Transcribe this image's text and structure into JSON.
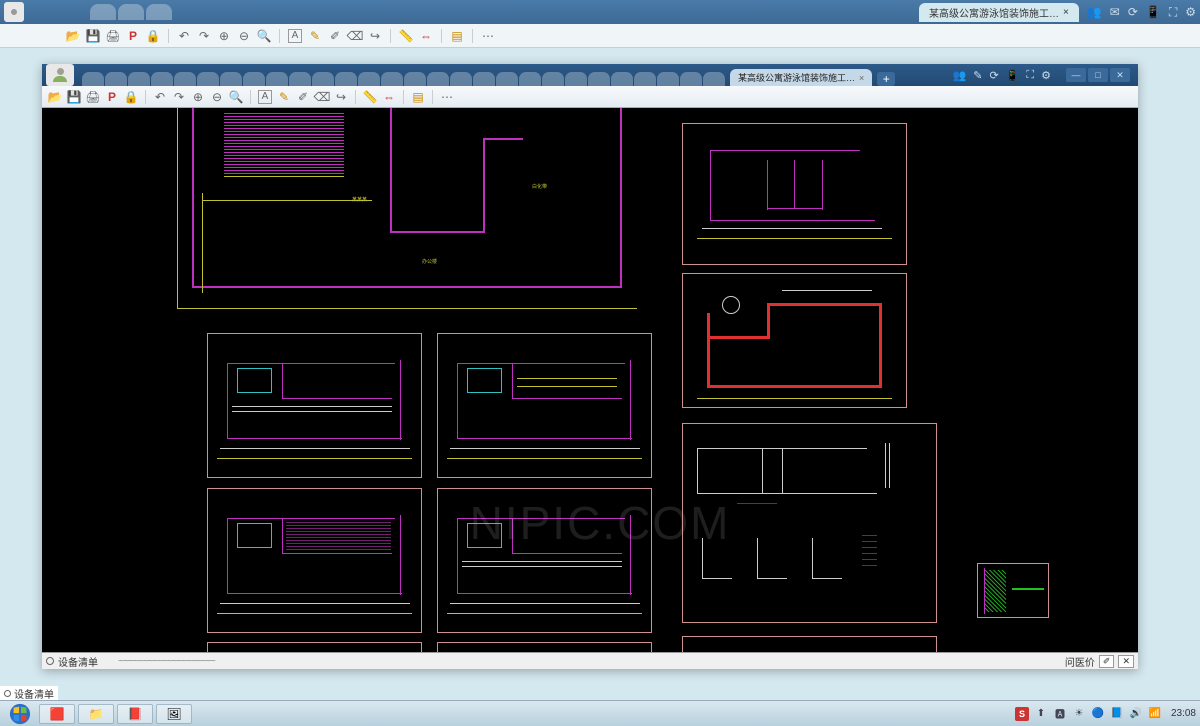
{
  "outer": {
    "tab_title": "某高级公寓游泳馆装饰施工…",
    "tab_close": "×",
    "right_icons": [
      "👥",
      "✉",
      "⟳",
      "📱",
      "⛶",
      "⚙"
    ]
  },
  "inner": {
    "tab_title": "某高级公寓游泳馆装饰施工…",
    "tab_close": "×",
    "plus": "+",
    "right_icons": [
      "👥",
      "✎",
      "⟳",
      "📱",
      "⛶",
      "⚙"
    ],
    "win_min": "—",
    "win_max": "□",
    "win_close": "✕"
  },
  "toolbar": {
    "open": "📂",
    "save": "💾",
    "print": "🖨",
    "pdf": "P",
    "undo": "↶",
    "redo": "↷",
    "zin": "⊕",
    "zout": "⊖",
    "zfit": "🔍",
    "text": "A",
    "pen": "✎",
    "edit": "✐",
    "erase": "⌫",
    "arrow": "↪",
    "ruler": "📏",
    "dim": "⇔",
    "layer": "▤",
    "more": "⋯"
  },
  "bottombar": {
    "left_label": "设备清单",
    "squiggle": "~~~~~~~~~~~~~~~~~~~~",
    "right_label": "问医价",
    "btn1": "✐",
    "btn2": "✕"
  },
  "taskbar": {
    "items": [
      "🟥",
      "📁",
      "📕",
      "🖼"
    ],
    "tray": [
      "S",
      "⬆",
      "🅰",
      "☀",
      "🔵",
      "📘",
      "🔊",
      "📶"
    ],
    "clock": "23:08"
  },
  "cad_labels": {
    "label1": "某某某",
    "label2": "办公楼",
    "label3": "白化带"
  },
  "watermark": "NIPIC.COM"
}
